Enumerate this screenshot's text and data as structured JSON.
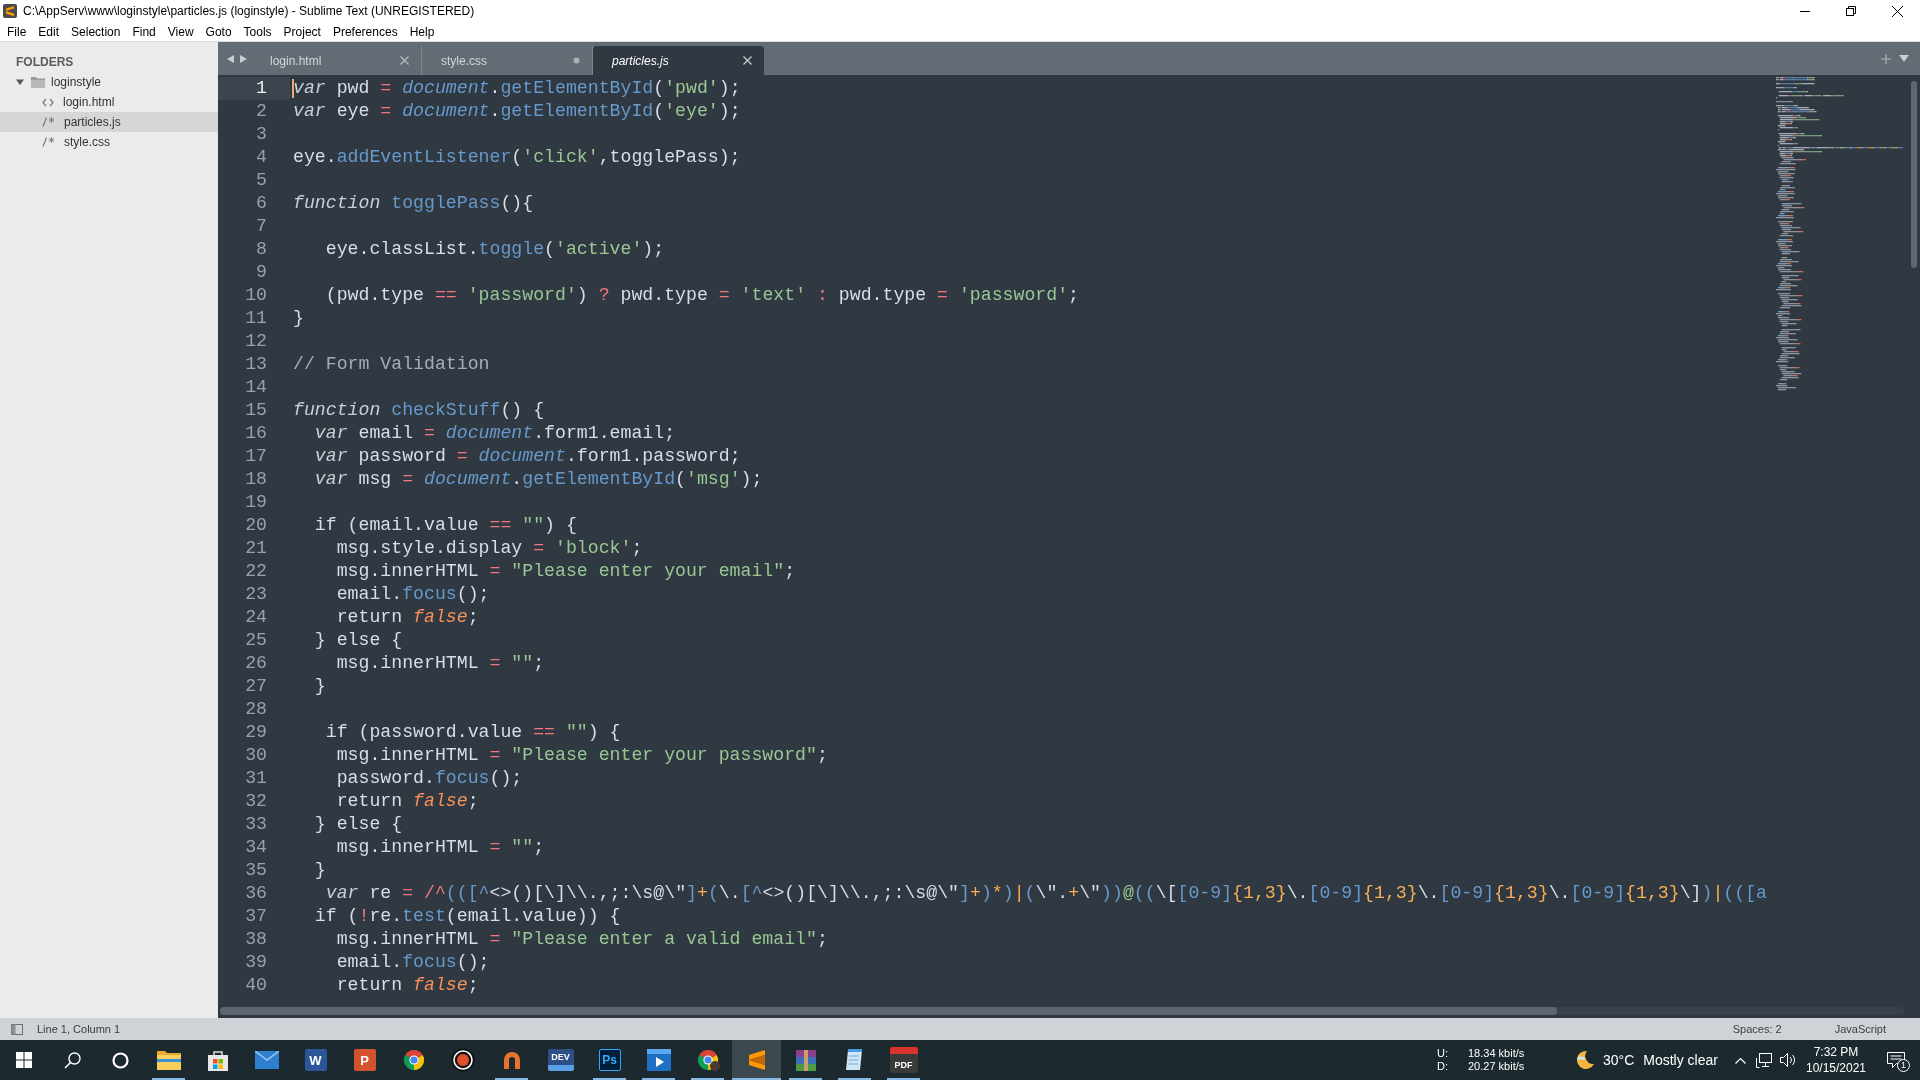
{
  "window": {
    "title": "C:\\AppServ\\www\\loginstyle\\particles.js (loginstyle) - Sublime Text (UNREGISTERED)"
  },
  "menu": [
    "File",
    "Edit",
    "Selection",
    "Find",
    "View",
    "Goto",
    "Tools",
    "Project",
    "Preferences",
    "Help"
  ],
  "sidebar": {
    "heading": "FOLDERS",
    "tree": [
      {
        "label": "loginstyle",
        "kind": "folder",
        "expanded": true,
        "selected": false,
        "children": [
          {
            "label": "login.html",
            "kind": "markup",
            "selected": false
          },
          {
            "label": "particles.js",
            "kind": "code",
            "selected": true
          },
          {
            "label": "style.css",
            "kind": "code",
            "selected": false
          }
        ]
      }
    ]
  },
  "tabs": [
    {
      "label": "login.html",
      "selected": false,
      "modified": false,
      "preview": false
    },
    {
      "label": "style.css",
      "selected": false,
      "modified": true,
      "preview": false
    },
    {
      "label": "particles.js",
      "selected": true,
      "modified": false,
      "preview": true
    }
  ],
  "editor": {
    "lines": [
      {
        "number": "1",
        "current": true,
        "tokens": [
          {
            "kind": "storage",
            "text": "var"
          },
          {
            "kind": "plain",
            "text": " pwd "
          },
          {
            "kind": "operator",
            "text": "= "
          },
          {
            "kind": "support",
            "text": "document"
          },
          {
            "kind": "plain",
            "text": "."
          },
          {
            "kind": "method",
            "text": "getElementById"
          },
          {
            "kind": "plain",
            "text": "("
          },
          {
            "kind": "string",
            "text": "'pwd'"
          },
          {
            "kind": "plain",
            "text": ");"
          }
        ]
      },
      {
        "number": "2",
        "current": false,
        "tokens": [
          {
            "kind": "storage",
            "text": "var"
          },
          {
            "kind": "plain",
            "text": " eye "
          },
          {
            "kind": "operator",
            "text": "= "
          },
          {
            "kind": "support",
            "text": "document"
          },
          {
            "kind": "plain",
            "text": "."
          },
          {
            "kind": "method",
            "text": "getElementById"
          },
          {
            "kind": "plain",
            "text": "("
          },
          {
            "kind": "string",
            "text": "'eye'"
          },
          {
            "kind": "plain",
            "text": ");"
          }
        ]
      },
      {
        "number": "3",
        "current": false
      },
      {
        "number": "4",
        "current": false,
        "tokens": [
          {
            "kind": "plain",
            "text": "eye."
          },
          {
            "kind": "method",
            "text": "addEventListener"
          },
          {
            "kind": "plain",
            "text": "("
          },
          {
            "kind": "string",
            "text": "'click'"
          },
          {
            "kind": "plain",
            "text": ",togglePass);"
          }
        ]
      },
      {
        "number": "5",
        "current": false
      },
      {
        "number": "6",
        "current": false,
        "tokens": [
          {
            "kind": "storage",
            "text": "function "
          },
          {
            "kind": "entity",
            "text": "togglePass"
          },
          {
            "kind": "plain",
            "text": "(){"
          }
        ]
      },
      {
        "number": "7",
        "current": false
      },
      {
        "number": "8",
        "current": false,
        "tokens": [
          {
            "kind": "plain",
            "text": "   eye.classList."
          },
          {
            "kind": "method",
            "text": "toggle"
          },
          {
            "kind": "plain",
            "text": "("
          },
          {
            "kind": "string",
            "text": "'active'"
          },
          {
            "kind": "plain",
            "text": ");"
          }
        ]
      },
      {
        "number": "9",
        "current": false
      },
      {
        "number": "10",
        "current": false,
        "tokens": [
          {
            "kind": "plain",
            "text": "   (pwd.type "
          },
          {
            "kind": "operator",
            "text": "== "
          },
          {
            "kind": "string",
            "text": "'password'"
          },
          {
            "kind": "plain",
            "text": ") "
          },
          {
            "kind": "operator",
            "text": "?"
          },
          {
            "kind": "plain",
            "text": " pwd.type "
          },
          {
            "kind": "operator",
            "text": "= "
          },
          {
            "kind": "string",
            "text": "'text' "
          },
          {
            "kind": "operator",
            "text": ":"
          },
          {
            "kind": "plain",
            "text": " pwd.type "
          },
          {
            "kind": "operator",
            "text": "= "
          },
          {
            "kind": "string",
            "text": "'password'"
          },
          {
            "kind": "plain",
            "text": ";"
          }
        ]
      },
      {
        "number": "11",
        "current": false,
        "tokens": [
          {
            "kind": "plain",
            "text": "}"
          }
        ]
      },
      {
        "number": "12",
        "current": false
      },
      {
        "number": "13",
        "current": false,
        "tokens": [
          {
            "kind": "comment",
            "text": "// Form Validation"
          }
        ]
      },
      {
        "number": "14",
        "current": false
      },
      {
        "number": "15",
        "current": false,
        "tokens": [
          {
            "kind": "storage",
            "text": "function "
          },
          {
            "kind": "entity",
            "text": "checkStuff"
          },
          {
            "kind": "plain",
            "text": "() {"
          }
        ]
      },
      {
        "number": "16",
        "current": false,
        "tokens": [
          {
            "kind": "storage",
            "text": "  var"
          },
          {
            "kind": "plain",
            "text": " email "
          },
          {
            "kind": "operator",
            "text": "= "
          },
          {
            "kind": "support",
            "text": "document"
          },
          {
            "kind": "plain",
            "text": ".form1.email;"
          }
        ]
      },
      {
        "number": "17",
        "current": false,
        "tokens": [
          {
            "kind": "storage",
            "text": "  var"
          },
          {
            "kind": "plain",
            "text": " password "
          },
          {
            "kind": "operator",
            "text": "= "
          },
          {
            "kind": "support",
            "text": "document"
          },
          {
            "kind": "plain",
            "text": ".form1.password;"
          }
        ]
      },
      {
        "number": "18",
        "current": false,
        "tokens": [
          {
            "kind": "storage",
            "text": "  var"
          },
          {
            "kind": "plain",
            "text": " msg "
          },
          {
            "kind": "operator",
            "text": "= "
          },
          {
            "kind": "support",
            "text": "document"
          },
          {
            "kind": "plain",
            "text": "."
          },
          {
            "kind": "method",
            "text": "getElementById"
          },
          {
            "kind": "plain",
            "text": "("
          },
          {
            "kind": "string",
            "text": "'msg'"
          },
          {
            "kind": "plain",
            "text": ");"
          }
        ]
      },
      {
        "number": "19",
        "current": false
      },
      {
        "number": "20",
        "current": false,
        "tokens": [
          {
            "kind": "plain",
            "text": "  if (email.value "
          },
          {
            "kind": "operator",
            "text": "== "
          },
          {
            "kind": "string",
            "text": "\"\""
          },
          {
            "kind": "plain",
            "text": ") {"
          }
        ]
      },
      {
        "number": "21",
        "current": false,
        "tokens": [
          {
            "kind": "plain",
            "text": "    msg.style.display "
          },
          {
            "kind": "operator",
            "text": "= "
          },
          {
            "kind": "string",
            "text": "'block'"
          },
          {
            "kind": "plain",
            "text": ";"
          }
        ]
      },
      {
        "number": "22",
        "current": false,
        "tokens": [
          {
            "kind": "plain",
            "text": "    msg.innerHTML "
          },
          {
            "kind": "operator",
            "text": "= "
          },
          {
            "kind": "string",
            "text": "\"Please enter your email\""
          },
          {
            "kind": "plain",
            "text": ";"
          }
        ]
      },
      {
        "number": "23",
        "current": false,
        "tokens": [
          {
            "kind": "plain",
            "text": "    email."
          },
          {
            "kind": "method",
            "text": "focus"
          },
          {
            "kind": "plain",
            "text": "();"
          }
        ]
      },
      {
        "number": "24",
        "current": false,
        "tokens": [
          {
            "kind": "plain",
            "text": "    return "
          },
          {
            "kind": "constant",
            "text": "false"
          },
          {
            "kind": "plain",
            "text": ";"
          }
        ]
      },
      {
        "number": "25",
        "current": false,
        "tokens": [
          {
            "kind": "plain",
            "text": "  } else {"
          }
        ]
      },
      {
        "number": "26",
        "current": false,
        "tokens": [
          {
            "kind": "plain",
            "text": "    msg.innerHTML "
          },
          {
            "kind": "operator",
            "text": "= "
          },
          {
            "kind": "string",
            "text": "\"\""
          },
          {
            "kind": "plain",
            "text": ";"
          }
        ]
      },
      {
        "number": "27",
        "current": false,
        "tokens": [
          {
            "kind": "plain",
            "text": "  }"
          }
        ]
      },
      {
        "number": "28",
        "current": false
      },
      {
        "number": "29",
        "current": false,
        "tokens": [
          {
            "kind": "plain",
            "text": "   if (password.value "
          },
          {
            "kind": "operator",
            "text": "== "
          },
          {
            "kind": "string",
            "text": "\"\""
          },
          {
            "kind": "plain",
            "text": ") {"
          }
        ]
      },
      {
        "number": "30",
        "current": false,
        "tokens": [
          {
            "kind": "plain",
            "text": "    msg.innerHTML "
          },
          {
            "kind": "operator",
            "text": "= "
          },
          {
            "kind": "string",
            "text": "\"Please enter your password\""
          },
          {
            "kind": "plain",
            "text": ";"
          }
        ]
      },
      {
        "number": "31",
        "current": false,
        "tokens": [
          {
            "kind": "plain",
            "text": "    password."
          },
          {
            "kind": "method",
            "text": "focus"
          },
          {
            "kind": "plain",
            "text": "();"
          }
        ]
      },
      {
        "number": "32",
        "current": false,
        "tokens": [
          {
            "kind": "plain",
            "text": "    return "
          },
          {
            "kind": "constant",
            "text": "false"
          },
          {
            "kind": "plain",
            "text": ";"
          }
        ]
      },
      {
        "number": "33",
        "current": false,
        "tokens": [
          {
            "kind": "plain",
            "text": "  } else {"
          }
        ]
      },
      {
        "number": "34",
        "current": false,
        "tokens": [
          {
            "kind": "plain",
            "text": "    msg.innerHTML "
          },
          {
            "kind": "operator",
            "text": "= "
          },
          {
            "kind": "string",
            "text": "\"\""
          },
          {
            "kind": "plain",
            "text": ";"
          }
        ]
      },
      {
        "number": "35",
        "current": false,
        "tokens": [
          {
            "kind": "plain",
            "text": "  }"
          }
        ]
      },
      {
        "number": "36",
        "current": false,
        "tokens": [
          {
            "kind": "storage",
            "text": "   var"
          },
          {
            "kind": "plain",
            "text": " re "
          },
          {
            "kind": "operator",
            "text": "= "
          },
          {
            "kind": "regex_delim",
            "text": "/^"
          },
          {
            "kind": "regex_group",
            "text": "(([^"
          },
          {
            "kind": "regex_char",
            "text": "<>()["
          },
          {
            "kind": "regex_escape",
            "text": "\\]\\\\"
          },
          {
            "kind": "regex_char",
            "text": ".,;:"
          },
          {
            "kind": "regex_escape",
            "text": "\\s"
          },
          {
            "kind": "regex_char",
            "text": "@"
          },
          {
            "kind": "regex_escape",
            "text": "\\\""
          },
          {
            "kind": "regex_group",
            "text": "]"
          },
          {
            "kind": "regex_quant",
            "text": "+"
          },
          {
            "kind": "regex_group",
            "text": "("
          },
          {
            "kind": "regex_escape",
            "text": "\\."
          },
          {
            "kind": "regex_group",
            "text": "[^"
          },
          {
            "kind": "regex_char",
            "text": "<>()["
          },
          {
            "kind": "regex_escape",
            "text": "\\]\\\\"
          },
          {
            "kind": "regex_char",
            "text": ".,;:"
          },
          {
            "kind": "regex_escape",
            "text": "\\s"
          },
          {
            "kind": "regex_char",
            "text": "@"
          },
          {
            "kind": "regex_escape",
            "text": "\\\""
          },
          {
            "kind": "regex_group",
            "text": "]"
          },
          {
            "kind": "regex_quant",
            "text": "+"
          },
          {
            "kind": "regex_group",
            "text": ")"
          },
          {
            "kind": "regex_quant",
            "text": "*"
          },
          {
            "kind": "regex_group",
            "text": ")"
          },
          {
            "kind": "regex_quant",
            "text": "|"
          },
          {
            "kind": "regex_group",
            "text": "("
          },
          {
            "kind": "regex_escape",
            "text": "\\\""
          },
          {
            "kind": "regex_char",
            "text": "."
          },
          {
            "kind": "regex_quant",
            "text": "+"
          },
          {
            "kind": "regex_escape",
            "text": "\\\""
          },
          {
            "kind": "regex_group",
            "text": "))"
          },
          {
            "kind": "regex_literal",
            "text": "@"
          },
          {
            "kind": "regex_group",
            "text": "(("
          },
          {
            "kind": "regex_escape",
            "text": "\\["
          },
          {
            "kind": "regex_group",
            "text": "[0-9]"
          },
          {
            "kind": "regex_quant",
            "text": "{1,3}"
          },
          {
            "kind": "regex_escape",
            "text": "\\."
          },
          {
            "kind": "regex_group",
            "text": "[0-9]"
          },
          {
            "kind": "regex_quant",
            "text": "{1,3}"
          },
          {
            "kind": "regex_escape",
            "text": "\\."
          },
          {
            "kind": "regex_group",
            "text": "[0-9]"
          },
          {
            "kind": "regex_quant",
            "text": "{1,3}"
          },
          {
            "kind": "regex_escape",
            "text": "\\."
          },
          {
            "kind": "regex_group",
            "text": "[0-9]"
          },
          {
            "kind": "regex_quant",
            "text": "{1,3}"
          },
          {
            "kind": "regex_escape",
            "text": "\\]"
          },
          {
            "kind": "regex_group",
            "text": ")"
          },
          {
            "kind": "regex_quant",
            "text": "|"
          },
          {
            "kind": "regex_group",
            "text": "(([a"
          }
        ]
      },
      {
        "number": "37",
        "current": false,
        "tokens": [
          {
            "kind": "plain",
            "text": "  if ("
          },
          {
            "kind": "operator",
            "text": "!"
          },
          {
            "kind": "plain",
            "text": "re."
          },
          {
            "kind": "method",
            "text": "test"
          },
          {
            "kind": "plain",
            "text": "(email.value)) {"
          }
        ]
      },
      {
        "number": "38",
        "current": false,
        "tokens": [
          {
            "kind": "plain",
            "text": "    msg.innerHTML "
          },
          {
            "kind": "operator",
            "text": "= "
          },
          {
            "kind": "string",
            "text": "\"Please enter a valid email\""
          },
          {
            "kind": "plain",
            "text": ";"
          }
        ]
      },
      {
        "number": "39",
        "current": false,
        "tokens": [
          {
            "kind": "plain",
            "text": "    email."
          },
          {
            "kind": "method",
            "text": "focus"
          },
          {
            "kind": "plain",
            "text": "();"
          }
        ]
      },
      {
        "number": "40",
        "current": false,
        "tokens": [
          {
            "kind": "plain",
            "text": "    return "
          },
          {
            "kind": "constant",
            "text": "false"
          },
          {
            "kind": "plain",
            "text": ";"
          }
        ]
      }
    ]
  },
  "status_bar": {
    "position": "Line 1, Column 1",
    "indentation": "Spaces: 2",
    "syntax": "JavaScript"
  },
  "taskbar": {
    "apps": [
      {
        "kind": "folder",
        "running": true,
        "selected": false
      },
      {
        "kind": "store",
        "running": false,
        "selected": false
      },
      {
        "kind": "mail",
        "running": false,
        "selected": false
      },
      {
        "kind": "tile_word",
        "glyph": "W",
        "running": false,
        "selected": false
      },
      {
        "kind": "tile_slides",
        "glyph": "P",
        "running": false,
        "selected": false
      },
      {
        "kind": "browser",
        "running": false,
        "selected": false
      },
      {
        "kind": "recorder",
        "running": false,
        "selected": false
      },
      {
        "kind": "horseshoe",
        "running": true,
        "selected": false
      },
      {
        "kind": "tile_dev",
        "glyph": "DEV",
        "running": false,
        "selected": false
      },
      {
        "kind": "tile_ps",
        "glyph": "Ps",
        "running": true,
        "selected": false
      },
      {
        "kind": "player",
        "running": true,
        "selected": false
      },
      {
        "kind": "browser_profile",
        "running": true,
        "selected": false
      },
      {
        "kind": "editor",
        "running": true,
        "selected": true
      },
      {
        "kind": "archive",
        "running": true,
        "selected": false
      },
      {
        "kind": "notepad",
        "running": true,
        "selected": false
      },
      {
        "kind": "tile_pdf",
        "glyph": "PDF",
        "running": true,
        "selected": false
      }
    ],
    "network": {
      "up_label": "U:",
      "up": "18.34 kbit/s",
      "down_label": "D:",
      "down": "20.27 kbit/s"
    },
    "weather": {
      "temperature": "30°C",
      "condition": "Mostly clear"
    },
    "clock": {
      "time": "7:32 PM",
      "date": "10/15/2021"
    },
    "notifications": "1"
  }
}
